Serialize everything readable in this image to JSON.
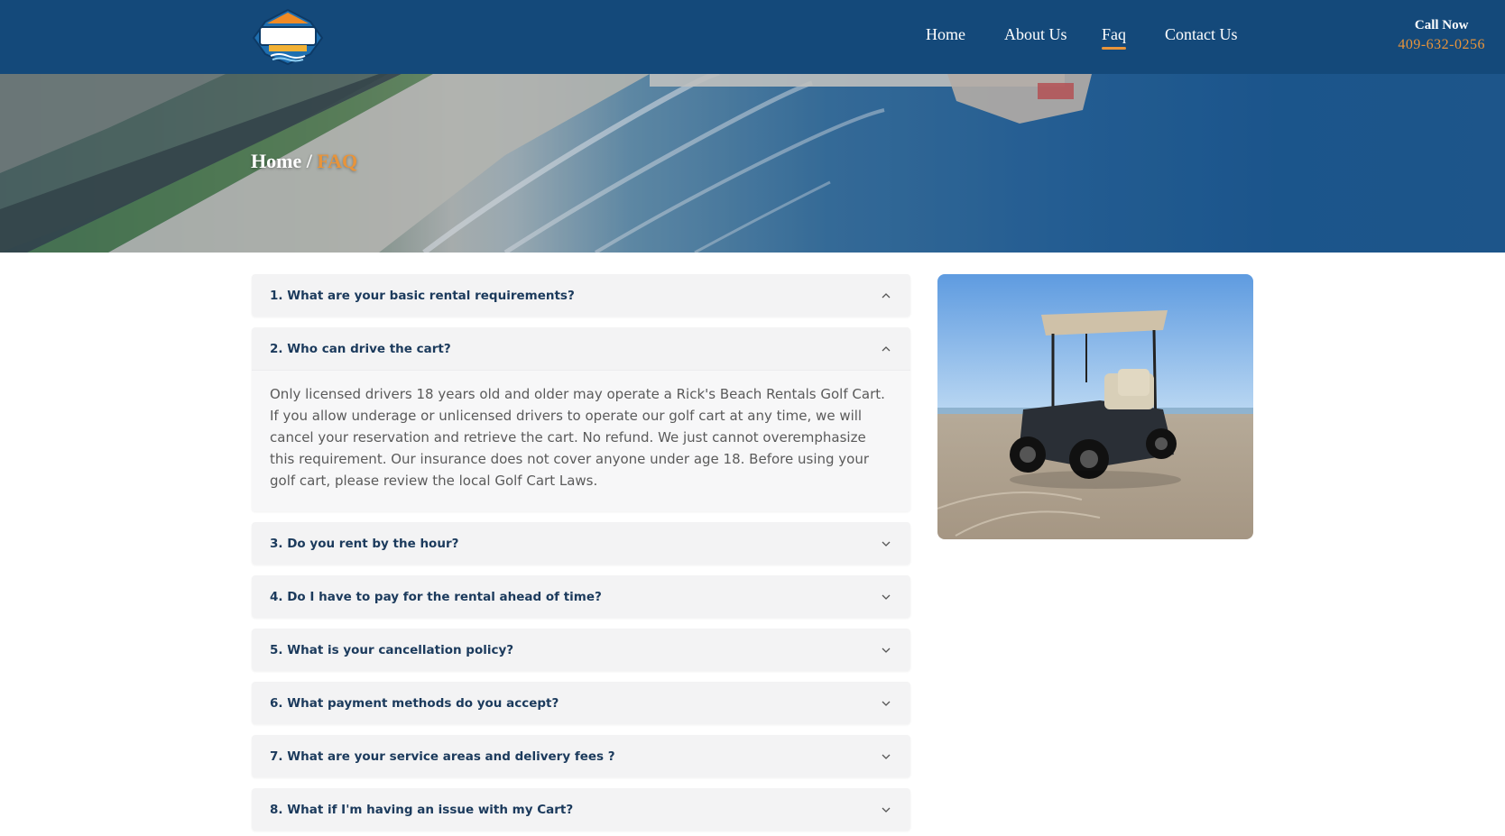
{
  "header": {
    "logo_alt": "RICK'S Beach Rentals logo",
    "logo_text": "RICK'S",
    "logo_subtext": "BEACH RENTALS",
    "nav": [
      {
        "label": "Home",
        "active": false
      },
      {
        "label": "About Us",
        "active": false
      },
      {
        "label": "Faq",
        "active": true
      },
      {
        "label": "Contact Us",
        "active": false
      }
    ],
    "call_label": "Call Now",
    "call_phone": "409-632-0256"
  },
  "hero": {
    "breadcrumb_home": "Home",
    "breadcrumb_sep": "/",
    "breadcrumb_current": "FAQ"
  },
  "faq": {
    "items": [
      {
        "question": "1. What are your basic rental requirements?",
        "expanded": false,
        "icon": "chevron-up-icon"
      },
      {
        "question": "2. Who can drive the cart?",
        "expanded": true,
        "icon": "chevron-up-icon",
        "answer": "Only licensed drivers 18 years old and older may operate a Rick's Beach Rentals Golf Cart. If you allow underage or unlicensed drivers to operate our golf cart at any time, we will cancel your reservation and retrieve the cart. No refund. We just cannot overemphasize this requirement. Our insurance does not cover anyone under age 18. Before using your golf cart, please review the local Golf Cart Laws."
      },
      {
        "question": "3. Do you rent by the hour?",
        "expanded": false,
        "icon": "chevron-down-icon"
      },
      {
        "question": "4. Do I have to pay for the rental ahead of time?",
        "expanded": false,
        "icon": "chevron-down-icon"
      },
      {
        "question": "5. What is your cancellation policy?",
        "expanded": false,
        "icon": "chevron-down-icon"
      },
      {
        "question": "6. What payment methods do you accept?",
        "expanded": false,
        "icon": "chevron-down-icon"
      },
      {
        "question": "7. What are your service areas and delivery fees ?",
        "expanded": false,
        "icon": "chevron-down-icon"
      },
      {
        "question": "8. What if I'm having an issue with my Cart?",
        "expanded": false,
        "icon": "chevron-down-icon"
      }
    ]
  },
  "colors": {
    "header_bg": "#14497a",
    "accent": "#e8943a",
    "question_text": "#1b3a5c",
    "item_bg": "#f3f3f4"
  }
}
